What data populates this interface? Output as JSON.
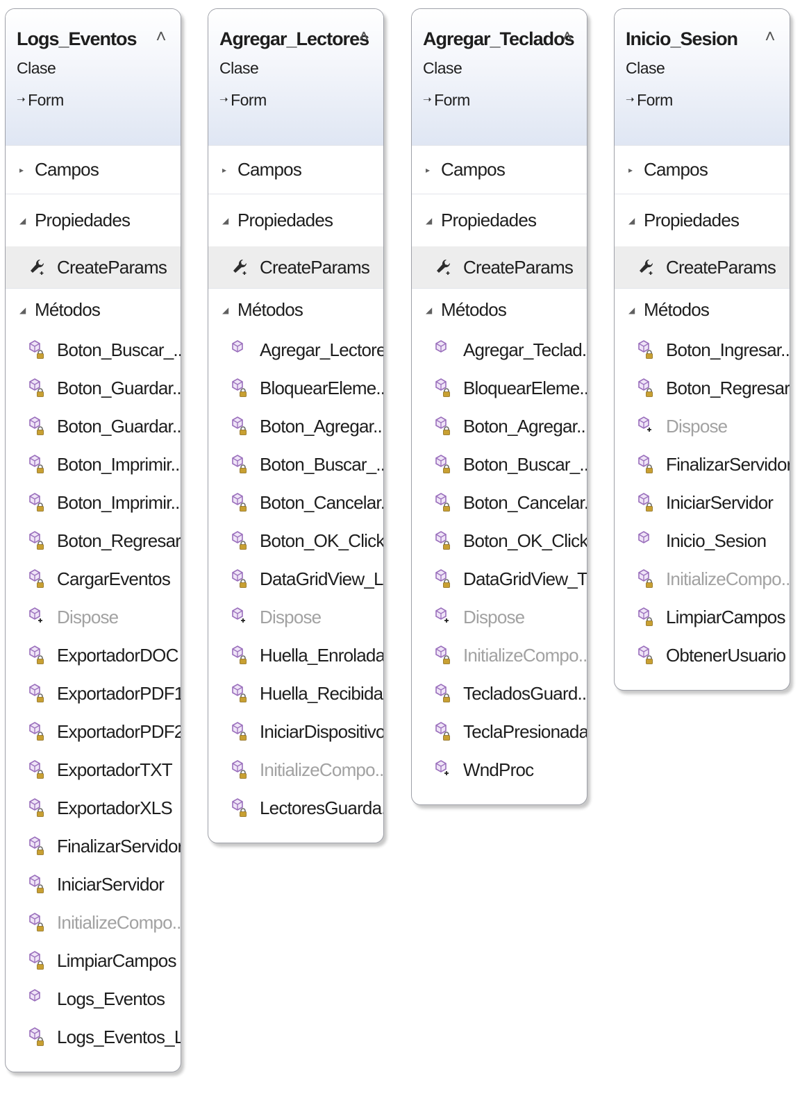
{
  "classes": [
    {
      "name": "Logs_Eventos",
      "kind": "Clase",
      "base": "Form",
      "sections": {
        "fields": "Campos",
        "properties": "Propiedades",
        "methods": "Métodos"
      },
      "properties": [
        {
          "label": "CreateParams",
          "icon": "wrench-icon"
        }
      ],
      "methods": [
        {
          "label": "Boton_Buscar_...",
          "access": "private"
        },
        {
          "label": "Boton_Guardar...",
          "access": "private"
        },
        {
          "label": "Boton_Guardar...",
          "access": "private"
        },
        {
          "label": "Boton_Imprimir...",
          "access": "private"
        },
        {
          "label": "Boton_Imprimir...",
          "access": "private"
        },
        {
          "label": "Boton_Regresar...",
          "access": "private"
        },
        {
          "label": "CargarEventos",
          "access": "private"
        },
        {
          "label": "Dispose",
          "access": "protected",
          "dimmed": true
        },
        {
          "label": "ExportadorDOC",
          "access": "private"
        },
        {
          "label": "ExportadorPDF1",
          "access": "private"
        },
        {
          "label": "ExportadorPDF2",
          "access": "private"
        },
        {
          "label": "ExportadorTXT",
          "access": "private"
        },
        {
          "label": "ExportadorXLS",
          "access": "private"
        },
        {
          "label": "FinalizarServidor",
          "access": "private"
        },
        {
          "label": "IniciarServidor",
          "access": "private"
        },
        {
          "label": "InitializeCompo...",
          "access": "private",
          "dimmed": true
        },
        {
          "label": "LimpiarCampos",
          "access": "private"
        },
        {
          "label": "Logs_Eventos",
          "access": "public"
        },
        {
          "label": "Logs_Eventos_L...",
          "access": "private"
        }
      ]
    },
    {
      "name": "Agregar_Lectores",
      "kind": "Clase",
      "base": "Form",
      "sections": {
        "fields": "Campos",
        "properties": "Propiedades",
        "methods": "Métodos"
      },
      "properties": [
        {
          "label": "CreateParams",
          "icon": "wrench-icon"
        }
      ],
      "methods": [
        {
          "label": "Agregar_Lectores",
          "access": "public"
        },
        {
          "label": "BloquearEleme...",
          "access": "private"
        },
        {
          "label": "Boton_Agregar...",
          "access": "private"
        },
        {
          "label": "Boton_Buscar_...",
          "access": "private"
        },
        {
          "label": "Boton_Cancelar...",
          "access": "private"
        },
        {
          "label": "Boton_OK_Click",
          "access": "private"
        },
        {
          "label": "DataGridView_L...",
          "access": "private"
        },
        {
          "label": "Dispose",
          "access": "protected",
          "dimmed": true
        },
        {
          "label": "Huella_Enrolada",
          "access": "private"
        },
        {
          "label": "Huella_Recibida",
          "access": "private"
        },
        {
          "label": "IniciarDispositivo",
          "access": "private"
        },
        {
          "label": "InitializeCompo...",
          "access": "private",
          "dimmed": true
        },
        {
          "label": "LectoresGuarda...",
          "access": "private"
        }
      ]
    },
    {
      "name": "Agregar_Teclados",
      "kind": "Clase",
      "base": "Form",
      "sections": {
        "fields": "Campos",
        "properties": "Propiedades",
        "methods": "Métodos"
      },
      "properties": [
        {
          "label": "CreateParams",
          "icon": "wrench-icon"
        }
      ],
      "methods": [
        {
          "label": "Agregar_Teclad...",
          "access": "public"
        },
        {
          "label": "BloquearEleme...",
          "access": "private"
        },
        {
          "label": "Boton_Agregar...",
          "access": "private"
        },
        {
          "label": "Boton_Buscar_...",
          "access": "private"
        },
        {
          "label": "Boton_Cancelar...",
          "access": "private"
        },
        {
          "label": "Boton_OK_Click",
          "access": "private"
        },
        {
          "label": "DataGridView_T...",
          "access": "private"
        },
        {
          "label": "Dispose",
          "access": "protected",
          "dimmed": true
        },
        {
          "label": "InitializeCompo...",
          "access": "private",
          "dimmed": true
        },
        {
          "label": "TecladosGuard...",
          "access": "private"
        },
        {
          "label": "TeclaPresionada",
          "access": "private"
        },
        {
          "label": "WndProc",
          "access": "protected"
        }
      ]
    },
    {
      "name": "Inicio_Sesion",
      "kind": "Clase",
      "base": "Form",
      "sections": {
        "fields": "Campos",
        "properties": "Propiedades",
        "methods": "Métodos"
      },
      "properties": [
        {
          "label": "CreateParams",
          "icon": "wrench-icon"
        }
      ],
      "methods": [
        {
          "label": "Boton_Ingresar...",
          "access": "private"
        },
        {
          "label": "Boton_Regresar...",
          "access": "private"
        },
        {
          "label": "Dispose",
          "access": "protected",
          "dimmed": true
        },
        {
          "label": "FinalizarServidor",
          "access": "private"
        },
        {
          "label": "IniciarServidor",
          "access": "private"
        },
        {
          "label": "Inicio_Sesion",
          "access": "public"
        },
        {
          "label": "InitializeCompo...",
          "access": "private",
          "dimmed": true
        },
        {
          "label": "LimpiarCampos",
          "access": "private"
        },
        {
          "label": "ObtenerUsuario",
          "access": "private"
        }
      ]
    }
  ],
  "colors": {
    "method_icon": "#9a6fbc",
    "lock": "#c8a032",
    "dimmed_text": "#a2a2a2",
    "header_gradient_end": "#dfe6f3"
  }
}
